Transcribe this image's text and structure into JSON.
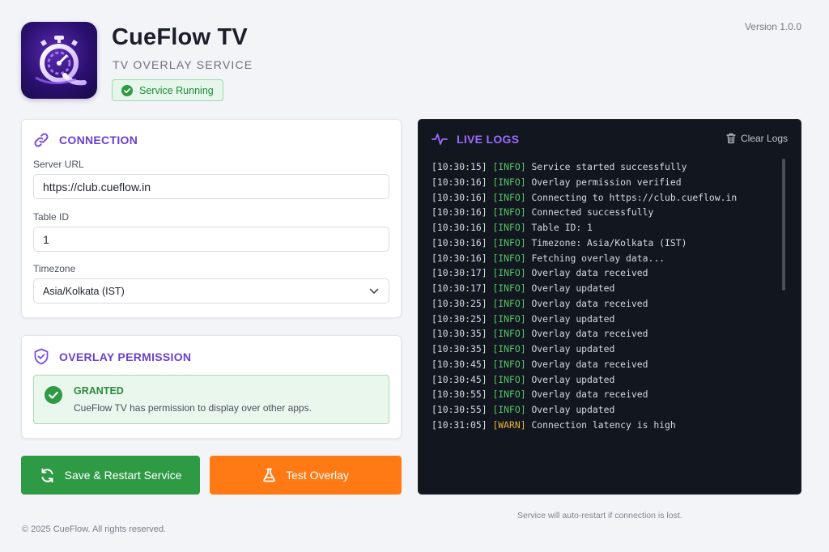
{
  "app": {
    "title": "CueFlow TV",
    "subtitle": "TV OVERLAY SERVICE",
    "status": "Service Running",
    "version": "Version 1.0.0",
    "icon": "stopwatch-q-icon"
  },
  "connection": {
    "heading": "CONNECTION",
    "server_url_label": "Server URL",
    "server_url_value": "https://club.cueflow.in",
    "table_id_label": "Table ID",
    "table_id_value": "1",
    "timezone_label": "Timezone",
    "timezone_value": "Asia/Kolkata (IST)"
  },
  "permission": {
    "heading": "OVERLAY PERMISSION",
    "status_title": "GRANTED",
    "status_text": "CueFlow TV has permission to display over other apps."
  },
  "actions": {
    "save_label": "Save & Restart Service",
    "test_label": "Test Overlay"
  },
  "logs": {
    "heading": "LIVE LOGS",
    "clear_label": "Clear Logs",
    "lines": [
      {
        "time": "[10:30:15]",
        "level": "[INFO]",
        "msg": "Service started successfully"
      },
      {
        "time": "[10:30:16]",
        "level": "[INFO]",
        "msg": "Overlay permission verified"
      },
      {
        "time": "[10:30:16]",
        "level": "[INFO]",
        "msg": "Connecting to https://club.cueflow.in"
      },
      {
        "time": "[10:30:16]",
        "level": "[INFO]",
        "msg": "Connected successfully"
      },
      {
        "time": "[10:30:16]",
        "level": "[INFO]",
        "msg": "Table ID: 1"
      },
      {
        "time": "[10:30:16]",
        "level": "[INFO]",
        "msg": "Timezone: Asia/Kolkata (IST)"
      },
      {
        "time": "[10:30:16]",
        "level": "[INFO]",
        "msg": "Fetching overlay data..."
      },
      {
        "time": "[10:30:17]",
        "level": "[INFO]",
        "msg": "Overlay data received"
      },
      {
        "time": "[10:30:17]",
        "level": "[INFO]",
        "msg": "Overlay updated"
      },
      {
        "time": "[10:30:25]",
        "level": "[INFO]",
        "msg": "Overlay data received"
      },
      {
        "time": "[10:30:25]",
        "level": "[INFO]",
        "msg": "Overlay updated"
      },
      {
        "time": "[10:30:35]",
        "level": "[INFO]",
        "msg": "Overlay data received"
      },
      {
        "time": "[10:30:35]",
        "level": "[INFO]",
        "msg": "Overlay updated"
      },
      {
        "time": "[10:30:45]",
        "level": "[INFO]",
        "msg": "Overlay data received"
      },
      {
        "time": "[10:30:45]",
        "level": "[INFO]",
        "msg": "Overlay updated"
      },
      {
        "time": "[10:30:55]",
        "level": "[INFO]",
        "msg": "Overlay data received"
      },
      {
        "time": "[10:30:55]",
        "level": "[INFO]",
        "msg": "Overlay updated"
      },
      {
        "time": "[10:31:05]",
        "level": "[WARN]",
        "msg": "Connection latency is high"
      }
    ]
  },
  "footer": {
    "copyright": "© 2025 CueFlow. All rights reserved.",
    "note": "Service will auto-restart if connection is lost."
  },
  "colors": {
    "accent": "#6a3fd1",
    "success": "#2f9a44",
    "orange": "#ff7a14",
    "info": "#57c66b",
    "warn": "#e8b13a",
    "log_bg": "#12161f"
  }
}
